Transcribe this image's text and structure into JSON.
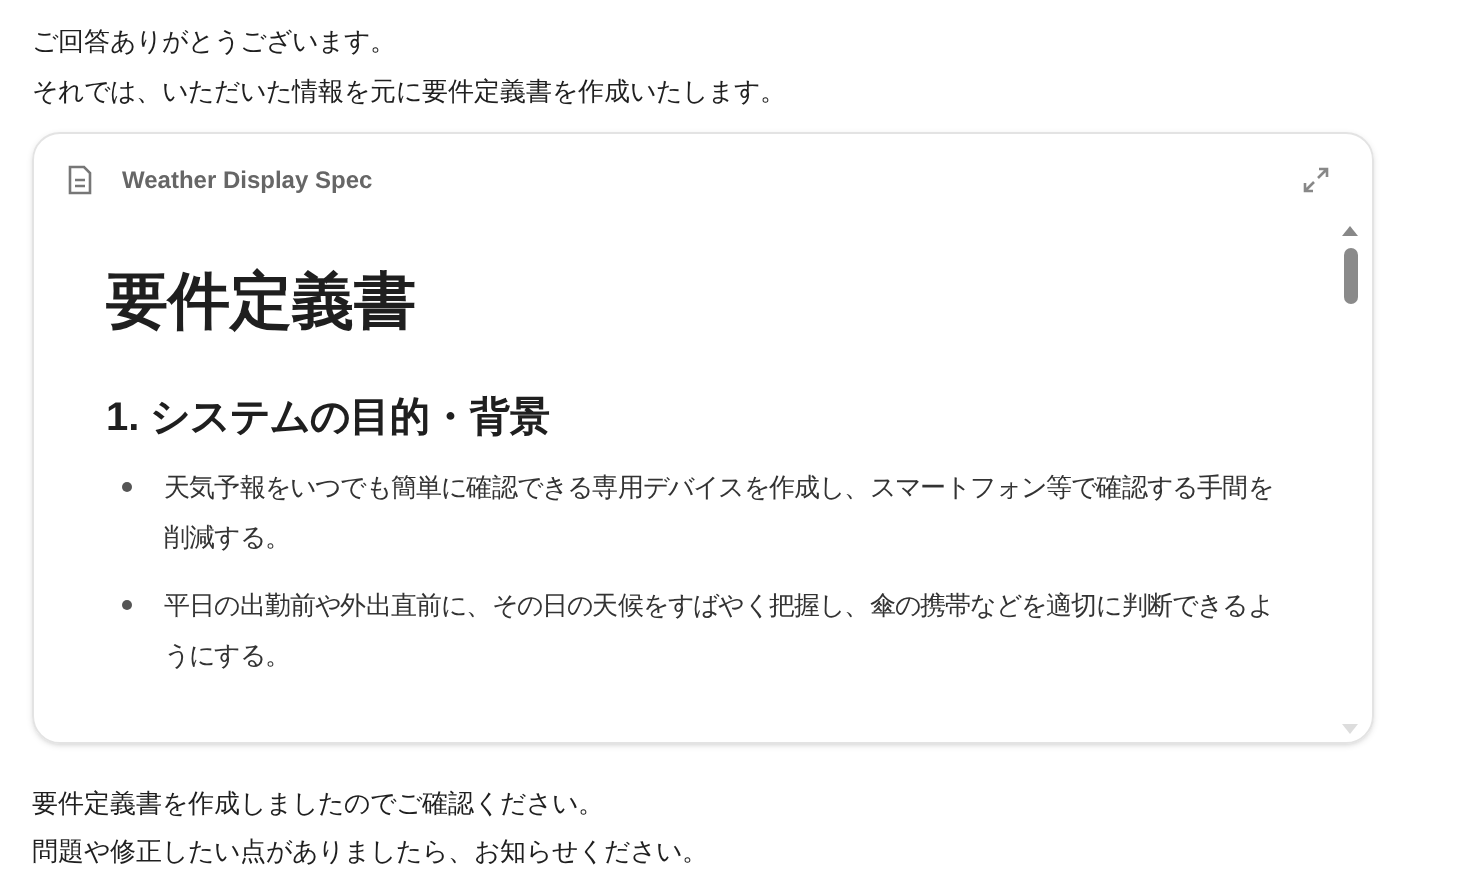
{
  "intro": [
    "ご回答ありがとうございます。",
    "それでは、いただいた情報を元に要件定義書を作成いたします。"
  ],
  "artifact": {
    "title": "Weather Display Spec",
    "heading": "要件定義書",
    "section_heading": "1. システムの目的・背景",
    "bullets": [
      "天気予報をいつでも簡単に確認できる専用デバイスを作成し、スマートフォン等で確認する手間を削減する。",
      "平日の出勤前や外出直前に、その日の天候をすばやく把握し、傘の携帯などを適切に判断できるようにする。"
    ]
  },
  "outro": [
    "要件定義書を作成しましたのでご確認ください。",
    "問題や修正したい点がありましたら、お知らせください。"
  ]
}
